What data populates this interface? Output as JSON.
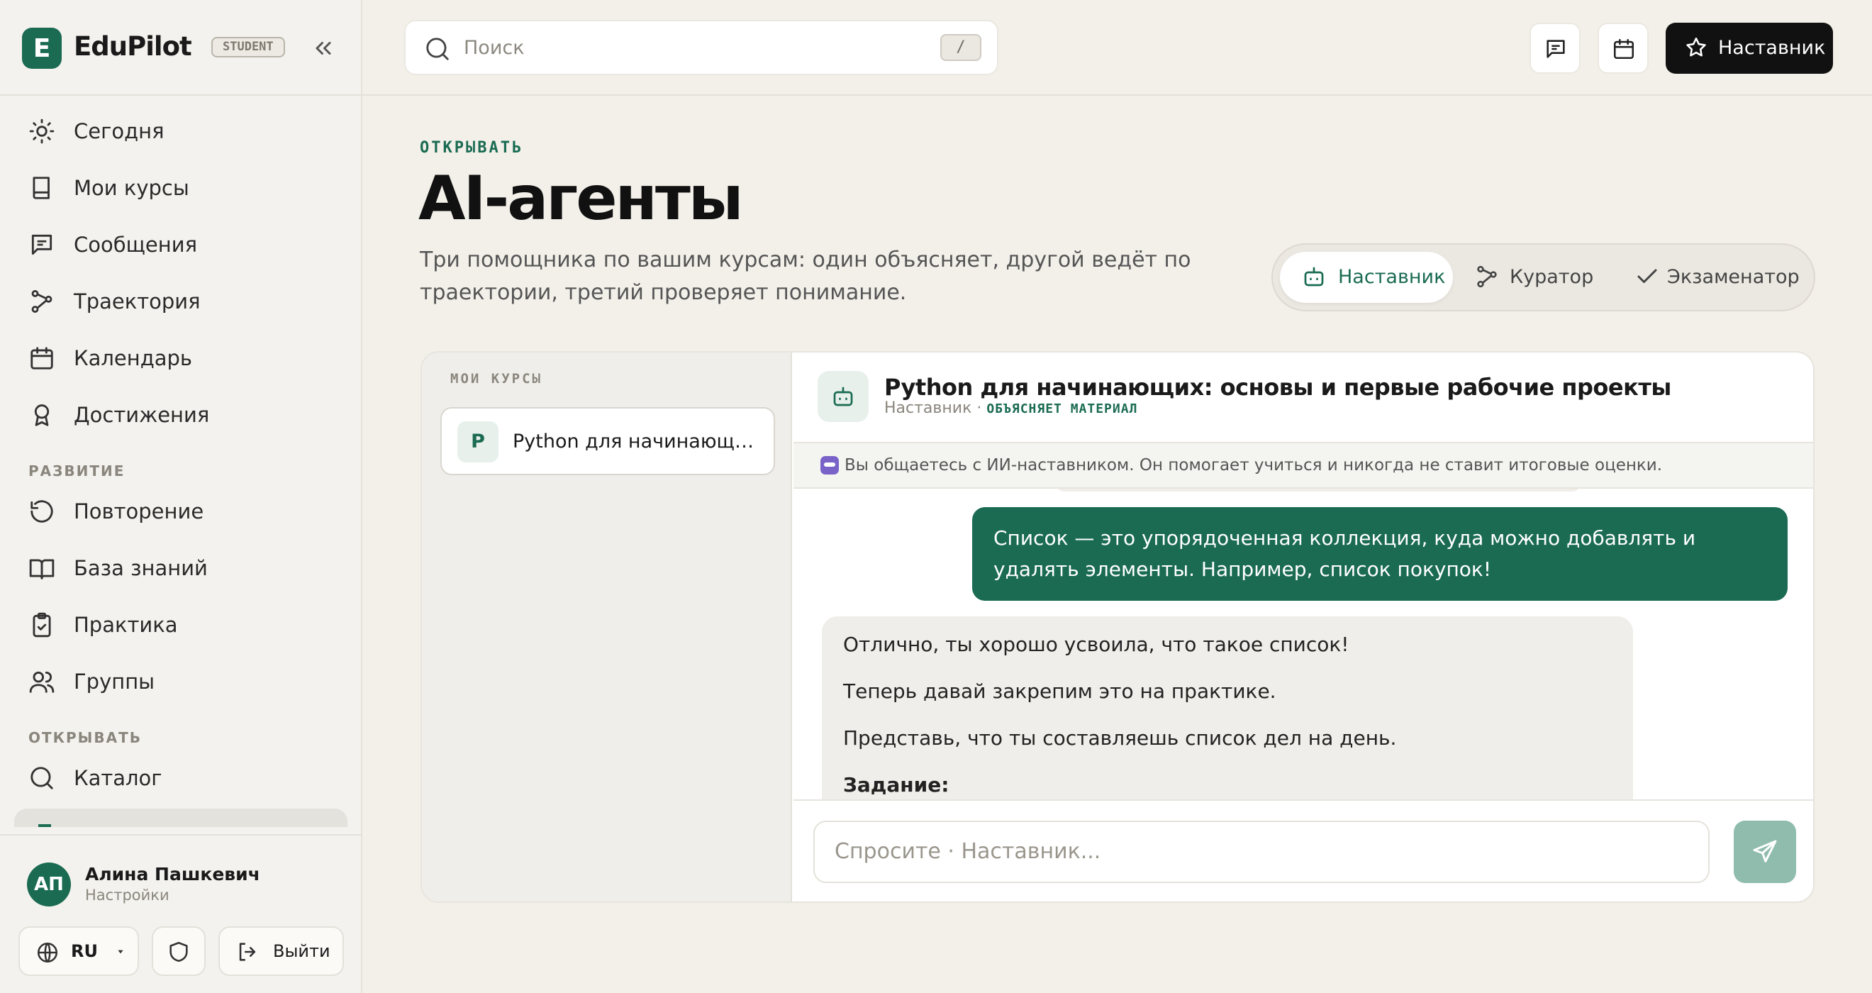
{
  "app": {
    "brand": "EduPilot",
    "logo_letter": "E",
    "badge": "STUDENT"
  },
  "nav": {
    "items": [
      {
        "label": "Сегодня",
        "icon": "sun-icon"
      },
      {
        "label": "Мои курсы",
        "icon": "book-icon"
      },
      {
        "label": "Сообщения",
        "icon": "message-icon"
      },
      {
        "label": "Траектория",
        "icon": "route-icon"
      },
      {
        "label": "Календарь",
        "icon": "calendar-icon"
      },
      {
        "label": "Достижения",
        "icon": "award-icon"
      }
    ],
    "section_growth": "РАЗВИТИЕ",
    "growth_items": [
      {
        "label": "Повторение",
        "icon": "rotate-icon"
      },
      {
        "label": "База знаний",
        "icon": "open-book-icon"
      },
      {
        "label": "Практика",
        "icon": "clipboard-check-icon"
      },
      {
        "label": "Группы",
        "icon": "users-icon"
      }
    ],
    "section_discover": "ОТКРЫВАТЬ",
    "discover_items": [
      {
        "label": "Каталог",
        "icon": "search-icon"
      }
    ]
  },
  "user": {
    "initials": "АП",
    "name": "Алина Пашкевич",
    "sub": "Настройки"
  },
  "footer": {
    "lang": "RU",
    "logout": "Выйти"
  },
  "topbar": {
    "search_placeholder": "Поиск",
    "search_shortcut": "/",
    "mentor_button": "Наставник"
  },
  "header": {
    "eyebrow": "ОТКРЫВАТЬ",
    "title": "AI-агенты",
    "description": "Три помощника по вашим курсам: один объясняет, другой ведёт по траектории, третий проверяет понимание."
  },
  "agents": {
    "tabs": [
      "Наставник",
      "Куратор",
      "Экзаменатор"
    ],
    "active": 0
  },
  "courses": {
    "caption": "МОИ КУРСЫ",
    "items": [
      {
        "mark": "P",
        "title": "Python для начинающих: основы и первые рабочие проекты"
      }
    ]
  },
  "chat": {
    "title": "Python для начинающих: основы и первые рабочие проекты",
    "agent_name": "Наставник",
    "separator": " · ",
    "mode": "ОБЪЯСНЯЕТ МАТЕРИАЛ",
    "notice": "Вы общаетесь с ИИ-наставником. Он помогает учиться и никогда не ставит итоговые оценки.",
    "messages": [
      {
        "role": "user",
        "text": "Список — это упорядоченная коллекция, куда можно добавлять и удалять элементы. Например, список покупок!"
      },
      {
        "role": "assistant",
        "paragraphs": [
          "Отлично, ты хорошо усвоила, что такое список!",
          "Теперь давай закрепим это на практике.",
          "Представь, что ты составляешь список дел на день."
        ],
        "task_label": "Задание:"
      }
    ],
    "input_placeholder": "Спросите · Наставник..."
  },
  "colors": {
    "accent": "#1a6b52",
    "dark": "#111111",
    "background": "#f3f0ea"
  }
}
